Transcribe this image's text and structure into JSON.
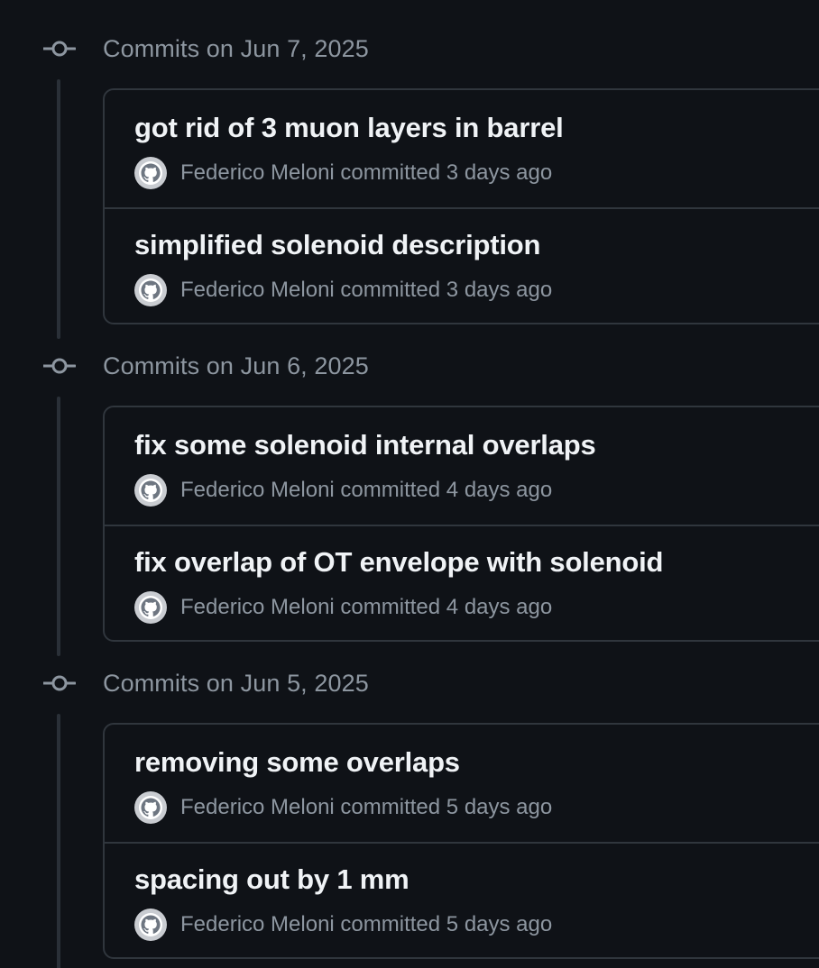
{
  "colors": {
    "background": "#0f1217",
    "border": "#30363d",
    "muted_text": "#8d96a0",
    "primary_text": "#f0f3f6",
    "avatar_bg": "#c9ccd1"
  },
  "icons": {
    "group_marker": "git-commit-icon",
    "avatar": "github-octocat-avatar-icon"
  },
  "groups": [
    {
      "title": "Commits on Jun 7, 2025",
      "commits": [
        {
          "message": "got rid of 3 muon layers in barrel",
          "author": "Federico Meloni",
          "action": "committed",
          "time": "3 days ago"
        },
        {
          "message": "simplified solenoid description",
          "author": "Federico Meloni",
          "action": "committed",
          "time": "3 days ago"
        }
      ]
    },
    {
      "title": "Commits on Jun 6, 2025",
      "commits": [
        {
          "message": "fix some solenoid internal overlaps",
          "author": "Federico Meloni",
          "action": "committed",
          "time": "4 days ago"
        },
        {
          "message": "fix overlap of OT envelope with solenoid",
          "author": "Federico Meloni",
          "action": "committed",
          "time": "4 days ago"
        }
      ]
    },
    {
      "title": "Commits on Jun 5, 2025",
      "commits": [
        {
          "message": "removing some overlaps",
          "author": "Federico Meloni",
          "action": "committed",
          "time": "5 days ago"
        },
        {
          "message": "spacing out by 1 mm",
          "author": "Federico Meloni",
          "action": "committed",
          "time": "5 days ago"
        }
      ]
    }
  ]
}
